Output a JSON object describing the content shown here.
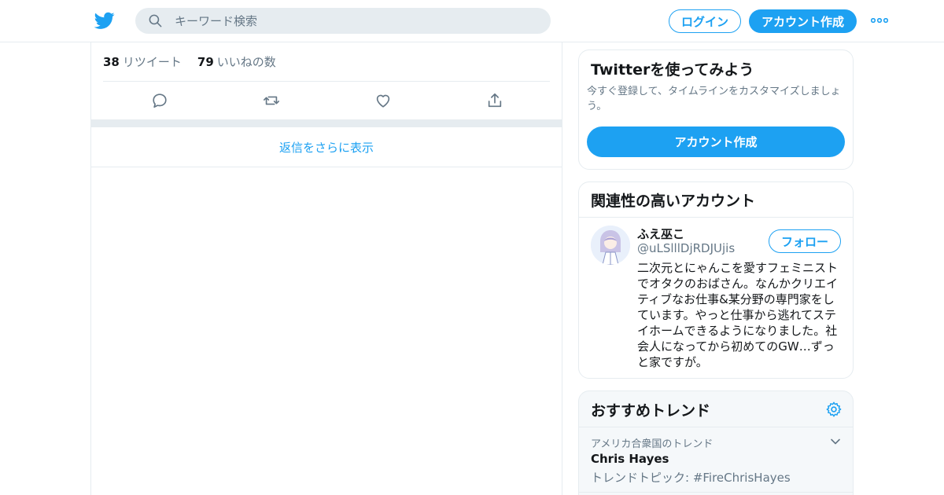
{
  "colors": {
    "accent": "#1da1f2",
    "muted": "#657786",
    "border": "#e6ecf0",
    "text": "#14171a"
  },
  "header": {
    "logo_icon": "twitter-bird-icon",
    "search_placeholder": "キーワード検索",
    "login_label": "ログイン",
    "signup_label": "アカウント作成",
    "more_icon": "more-dots-icon"
  },
  "tweet": {
    "retweet_count": "38",
    "retweet_label": "リツイート",
    "like_count": "79",
    "like_label": "いいねの数",
    "actions": [
      "reply-icon",
      "retweet-icon",
      "like-icon",
      "share-icon"
    ],
    "more_replies_label": "返信をさらに表示"
  },
  "signup_card": {
    "title": "Twitterを使ってみよう",
    "subtitle": "今すぐ登録して、タイムラインをカスタマイズしましょう。",
    "cta_label": "アカウント作成"
  },
  "related": {
    "title": "関連性の高いアカウント",
    "account": {
      "name": "ふえ巫こ",
      "handle": "@uLSlllDjRDJUjis",
      "follow_label": "フォロー",
      "bio": "二次元とにゃんこを愛すフェミニストでオタクのおばさん。なんかクリエイティブなお仕事&某分野の専門家をしています。やっと仕事から逃れてステイホームできるようになりました。社会人になってから初めてのGW…ずっと家ですが。"
    }
  },
  "trends": {
    "title": "おすすめトレンド",
    "settings_icon": "gear-icon",
    "items": [
      {
        "context": "アメリカ合衆国のトレンド",
        "name": "Chris Hayes",
        "description": "トレンドトピック: #FireChrisHayes"
      }
    ]
  }
}
